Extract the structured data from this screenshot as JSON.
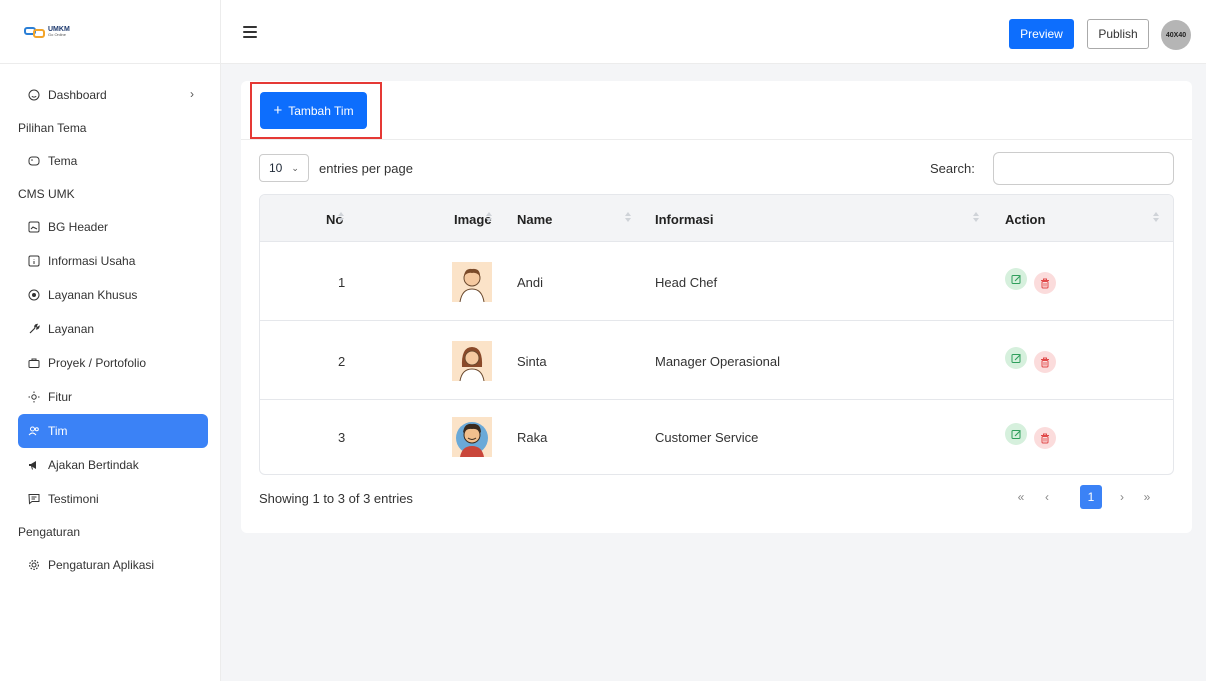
{
  "brand": {
    "logo_text": "UMKM",
    "logo_subtext": "Go Online"
  },
  "sidebar": {
    "items": [
      {
        "type": "item",
        "label": "Dashboard",
        "icon": "smile-icon",
        "chevron": true
      },
      {
        "type": "section",
        "label": "Pilihan Tema"
      },
      {
        "type": "item",
        "label": "Tema",
        "icon": "palette-icon"
      },
      {
        "type": "section",
        "label": "CMS UMK"
      },
      {
        "type": "item",
        "label": "BG Header",
        "icon": "image-icon"
      },
      {
        "type": "item",
        "label": "Informasi Usaha",
        "icon": "info-box-icon"
      },
      {
        "type": "item",
        "label": "Layanan Khusus",
        "icon": "star-circle-icon"
      },
      {
        "type": "item",
        "label": "Layanan",
        "icon": "wrench-icon"
      },
      {
        "type": "item",
        "label": "Proyek / Portofolio",
        "icon": "briefcase-icon"
      },
      {
        "type": "item",
        "label": "Fitur",
        "icon": "bulb-icon"
      },
      {
        "type": "item",
        "label": "Tim",
        "icon": "users-icon",
        "active": true
      },
      {
        "type": "item",
        "label": "Ajakan Bertindak",
        "icon": "megaphone-icon"
      },
      {
        "type": "item",
        "label": "Testimoni",
        "icon": "chat-icon"
      },
      {
        "type": "section",
        "label": "Pengaturan"
      },
      {
        "type": "item",
        "label": "Pengaturan Aplikasi",
        "icon": "gear-icon"
      }
    ]
  },
  "topbar": {
    "preview_label": "Preview",
    "publish_label": "Publish",
    "avatar_text": "40X40"
  },
  "main": {
    "add_button_label": "Tambah Tim",
    "entries_value": "10",
    "entries_label": "entries per page",
    "search_label": "Search:",
    "search_value": "",
    "columns": [
      "No",
      "Image",
      "Name",
      "Informasi",
      "Action"
    ],
    "rows": [
      {
        "no": "1",
        "name": "Andi",
        "informasi": "Head Chef",
        "avatar": "avatar-man-icon"
      },
      {
        "no": "2",
        "name": "Sinta",
        "informasi": "Manager Operasional",
        "avatar": "avatar-woman-icon"
      },
      {
        "no": "3",
        "name": "Raka",
        "informasi": "Customer Service",
        "avatar": "avatar-boy-icon"
      }
    ],
    "info_text": "Showing 1 to 3 of 3 entries",
    "pagination": {
      "first": "«",
      "prev": "‹",
      "current": "1",
      "next": "›",
      "last": "»"
    }
  },
  "colors": {
    "primary": "#0d6efd",
    "active_menu": "#3b82f6",
    "highlight": "#e53935",
    "edit_bg": "#d6f0dd",
    "delete_bg": "#fbdcdc"
  }
}
